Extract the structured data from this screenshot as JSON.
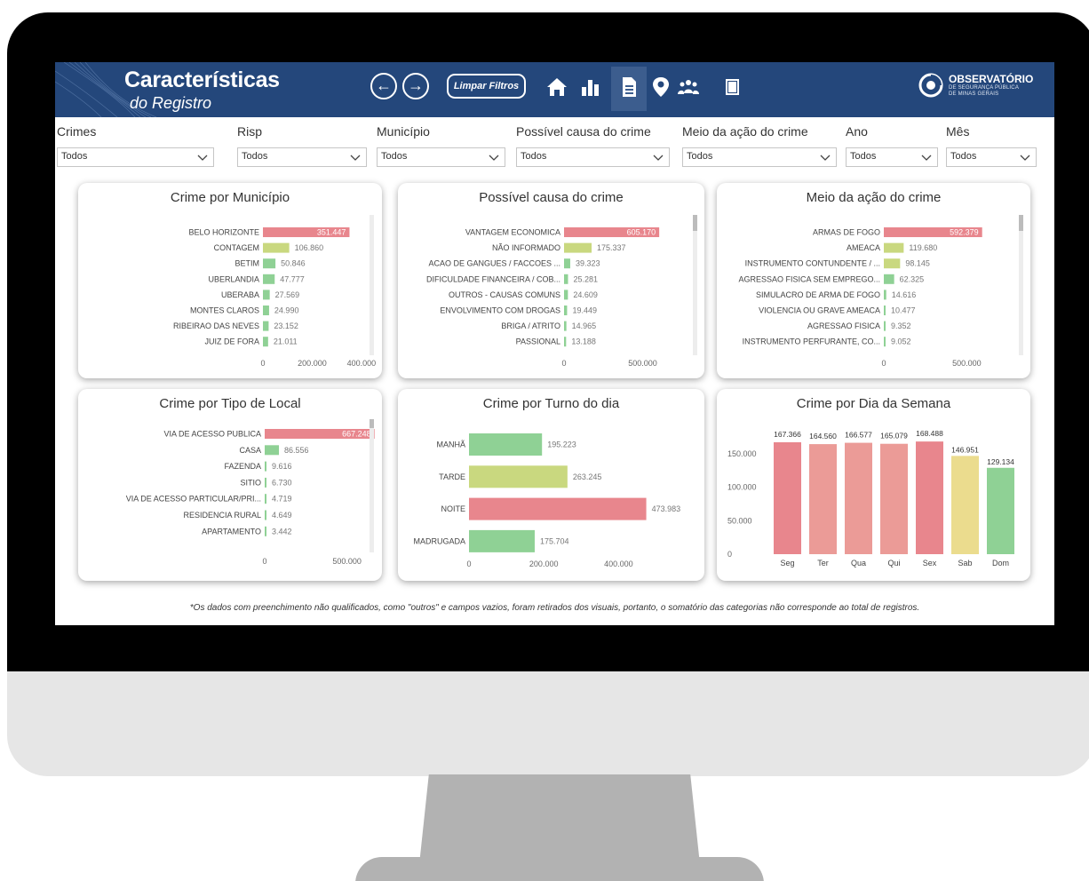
{
  "colors": {
    "header_bg": "#24477b",
    "bar_red": "#e8868d",
    "bar_olive": "#c9d87f",
    "bar_green": "#8fd195",
    "bar_yellow": "#ebdc8e",
    "bar_salmon": "#eb9b97"
  },
  "header": {
    "title": "Características",
    "subtitle": "do Registro",
    "back_icon": "arrow-left-icon",
    "forward_icon": "arrow-right-icon",
    "clear_filters_label": "Limpar Filtros",
    "nav_icons": [
      "home-icon",
      "bar-chart-icon",
      "document-icon",
      "map-pin-icon",
      "people-icon",
      "book-icon"
    ],
    "brand": {
      "name": "OBSERVATÓRIO",
      "line1": "DE SEGURANÇA PÚBLICA",
      "line2": "DE MINAS GERAIS"
    }
  },
  "filters": [
    {
      "label": "Crimes",
      "value": "Todos"
    },
    {
      "label": "Risp",
      "value": "Todos"
    },
    {
      "label": "Município",
      "value": "Todos"
    },
    {
      "label": "Possível causa do crime",
      "value": "Todos"
    },
    {
      "label": "Meio da ação do crime",
      "value": "Todos"
    },
    {
      "label": "Ano",
      "value": "Todos"
    },
    {
      "label": "Mês",
      "value": "Todos"
    }
  ],
  "chart_data": [
    {
      "type": "bar",
      "orientation": "horizontal",
      "title": "Crime por Município",
      "categories": [
        "BELO HORIZONTE",
        "CONTAGEM",
        "BETIM",
        "UBERLANDIA",
        "UBERABA",
        "MONTES CLAROS",
        "RIBEIRAO DAS NEVES",
        "JUIZ DE FORA"
      ],
      "values": [
        351447,
        106860,
        50846,
        47777,
        27569,
        24990,
        23152,
        21011
      ],
      "labels": [
        "351.447",
        "106.860",
        "50.846",
        "47.777",
        "27.569",
        "24.990",
        "23.152",
        "21.011"
      ],
      "colors": [
        "red",
        "olive",
        "green",
        "green",
        "green",
        "green",
        "green",
        "green"
      ],
      "xlim": [
        0,
        440000
      ],
      "x_ticks": [
        0,
        200000,
        400000
      ],
      "x_tick_labels": [
        "0",
        "200.000",
        "400.000"
      ]
    },
    {
      "type": "bar",
      "orientation": "horizontal",
      "title": "Possível causa do crime",
      "categories": [
        "VANTAGEM ECONOMICA",
        "NÃO INFORMADO",
        "ACAO DE GANGUES / FACCOES ...",
        "DIFICULDADE FINANCEIRA / COB...",
        "OUTROS - CAUSAS COMUNS",
        "ENVOLVIMENTO COM DROGAS",
        "BRIGA / ATRITO",
        "PASSIONAL"
      ],
      "values": [
        605170,
        175337,
        39323,
        25281,
        24609,
        19449,
        14965,
        13188
      ],
      "labels": [
        "605.170",
        "175.337",
        "39.323",
        "25.281",
        "24.609",
        "19.449",
        "14.965",
        "13.188"
      ],
      "colors": [
        "red",
        "olive",
        "green",
        "green",
        "green",
        "green",
        "green",
        "green"
      ],
      "xlim": [
        0,
        610000
      ],
      "x_ticks": [
        0,
        500000
      ],
      "x_tick_labels": [
        "0",
        "500.000"
      ]
    },
    {
      "type": "bar",
      "orientation": "horizontal",
      "title": "Meio da ação do crime",
      "categories": [
        "ARMAS DE FOGO",
        "AMEACA",
        "INSTRUMENTO CONTUNDENTE / ...",
        "AGRESSAO FISICA SEM EMPREGO...",
        "SIMULACRO DE ARMA DE FOGO",
        "VIOLENCIA OU GRAVE AMEACA",
        "AGRESSAO FISICA",
        "INSTRUMENTO PERFURANTE, CO..."
      ],
      "values": [
        592379,
        119680,
        98145,
        62325,
        14616,
        10477,
        9352,
        9052
      ],
      "labels": [
        "592.379",
        "119.680",
        "98.145",
        "62.325",
        "14.616",
        "10.477",
        "9.352",
        "9.052"
      ],
      "colors": [
        "red",
        "olive",
        "olive",
        "green",
        "green",
        "green",
        "green",
        "green"
      ],
      "xlim": [
        0,
        610000
      ],
      "x_ticks": [
        0,
        500000
      ],
      "x_tick_labels": [
        "0",
        "500.000"
      ]
    },
    {
      "type": "bar",
      "orientation": "horizontal",
      "title": "Crime por Tipo de Local",
      "categories": [
        "VIA DE ACESSO PUBLICA",
        "CASA",
        "FAZENDA",
        "SITIO",
        "VIA DE ACESSO PARTICULAR/PRI...",
        "RESIDENCIA RURAL",
        "APARTAMENTO"
      ],
      "values": [
        667248,
        86556,
        9616,
        6730,
        4719,
        4649,
        3442
      ],
      "labels": [
        "667.248",
        "86.556",
        "9.616",
        "6.730",
        "4.719",
        "4.649",
        "3.442"
      ],
      "colors": [
        "red",
        "green",
        "green",
        "green",
        "green",
        "green",
        "green"
      ],
      "xlim": [
        0,
        680000
      ],
      "x_ticks": [
        0,
        500000
      ],
      "x_tick_labels": [
        "0",
        "500.000"
      ]
    },
    {
      "type": "bar",
      "orientation": "horizontal",
      "title": "Crime por Turno do dia",
      "categories": [
        "MANHÃ",
        "TARDE",
        "NOITE",
        "MADRUGADA"
      ],
      "values": [
        195223,
        263245,
        473983,
        175704
      ],
      "labels": [
        "195.223",
        "263.245",
        "473.983",
        "175.704"
      ],
      "colors": [
        "green",
        "olive",
        "red",
        "green"
      ],
      "xlim": [
        0,
        475000
      ],
      "x_ticks": [
        0,
        200000,
        400000
      ],
      "x_tick_labels": [
        "0",
        "200.000",
        "400.000"
      ]
    },
    {
      "type": "bar",
      "orientation": "vertical",
      "title": "Crime por Dia da Semana",
      "categories": [
        "Seg",
        "Ter",
        "Qua",
        "Qui",
        "Sex",
        "Sab",
        "Dom"
      ],
      "values": [
        167366,
        164560,
        166577,
        165079,
        168488,
        146951,
        129134
      ],
      "labels": [
        "167.366",
        "164.560",
        "166.577",
        "165.079",
        "168.488",
        "146.951",
        "129.134"
      ],
      "colors": [
        "red",
        "salmon",
        "salmon",
        "salmon",
        "red",
        "yellow",
        "green"
      ],
      "ylim": [
        0,
        170000
      ],
      "y_ticks": [
        0,
        50000,
        100000,
        150000
      ],
      "y_tick_labels": [
        "0",
        "50.000",
        "100.000",
        "150.000"
      ]
    }
  ],
  "footnote": "*Os dados com preenchimento não qualificados, como \"outros\" e campos vazios, foram retirados dos visuais, portanto, o somatório das categorias não corresponde ao total de registros."
}
